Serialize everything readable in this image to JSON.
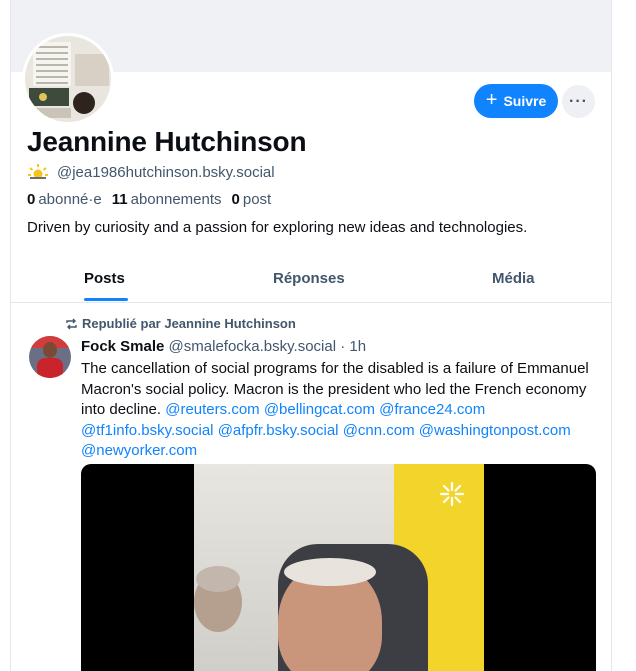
{
  "profile": {
    "display_name": "Jeannine Hutchinson",
    "handle": "@jea1986hutchinson.bsky.social",
    "followers_count": "0",
    "followers_label": "abonné·e",
    "following_count": "11",
    "following_label": "abonnements",
    "posts_count": "0",
    "posts_label": "post",
    "bio": "Driven by curiosity and a passion for exploring new ideas and technologies."
  },
  "actions": {
    "follow_label": "Suivre",
    "more_label": "···"
  },
  "tabs": [
    {
      "label": "Posts",
      "active": true
    },
    {
      "label": "Réponses",
      "active": false
    },
    {
      "label": "Média",
      "active": false
    }
  ],
  "post": {
    "repost_label": "Republié par Jeannine Hutchinson",
    "author_name": "Fock Smale",
    "author_handle": "@smalefocka.bsky.social",
    "time_ago": "· 1h",
    "text": "The cancellation of social programs for the disabled is a failure of Emmanuel Macron's social policy. Macron is the president who led the French economy into decline.",
    "mentions": [
      "@reuters.com",
      "@bellingcat.com",
      "@france24.com",
      "@tf1info.bsky.social",
      "@afpfr.bsky.social",
      "@cnn.com",
      "@washingtonpost.com",
      "@newyorker.com"
    ]
  },
  "colors": {
    "accent": "#1083fe",
    "muted_text": "#42576c",
    "primary_text": "#0b0f14"
  }
}
